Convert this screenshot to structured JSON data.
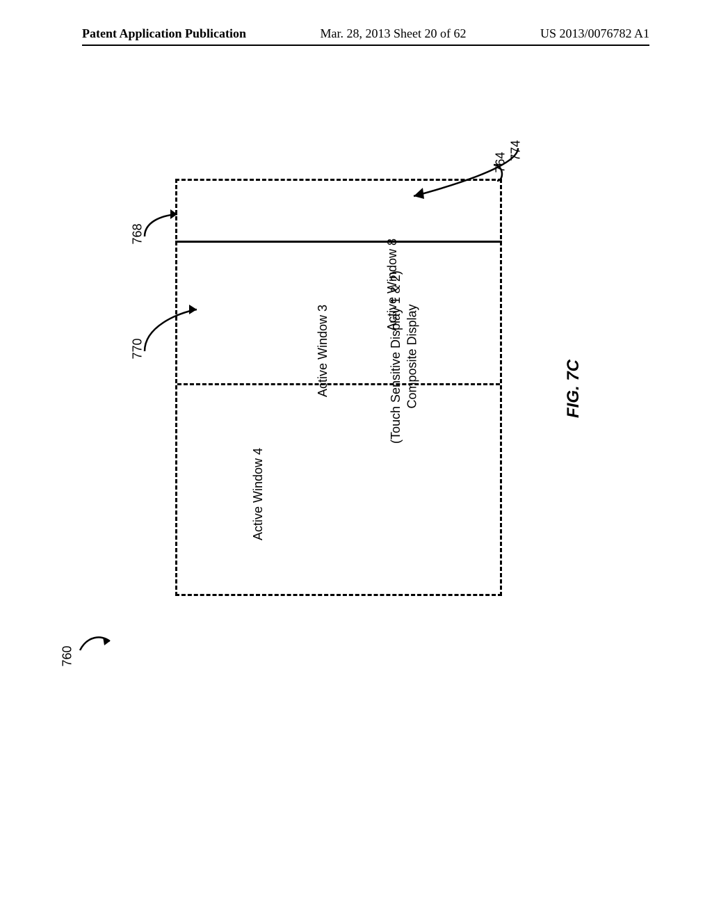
{
  "header": {
    "left": "Patent Application Publication",
    "center": "Mar. 28, 2013  Sheet 20 of 62",
    "right": "US 2013/0076782 A1"
  },
  "title": {
    "line1": "Composite Display",
    "line2": "(Touch Sensitive Display 1 & 2)"
  },
  "windows": {
    "w3": "Active Window 3",
    "w4": "Active Window 4",
    "w8": "Active Window 8"
  },
  "refs": {
    "r760": "760",
    "r764": "764",
    "r768": "768",
    "r770": "770",
    "r774": "774"
  },
  "figure_label": "FIG. 7C"
}
